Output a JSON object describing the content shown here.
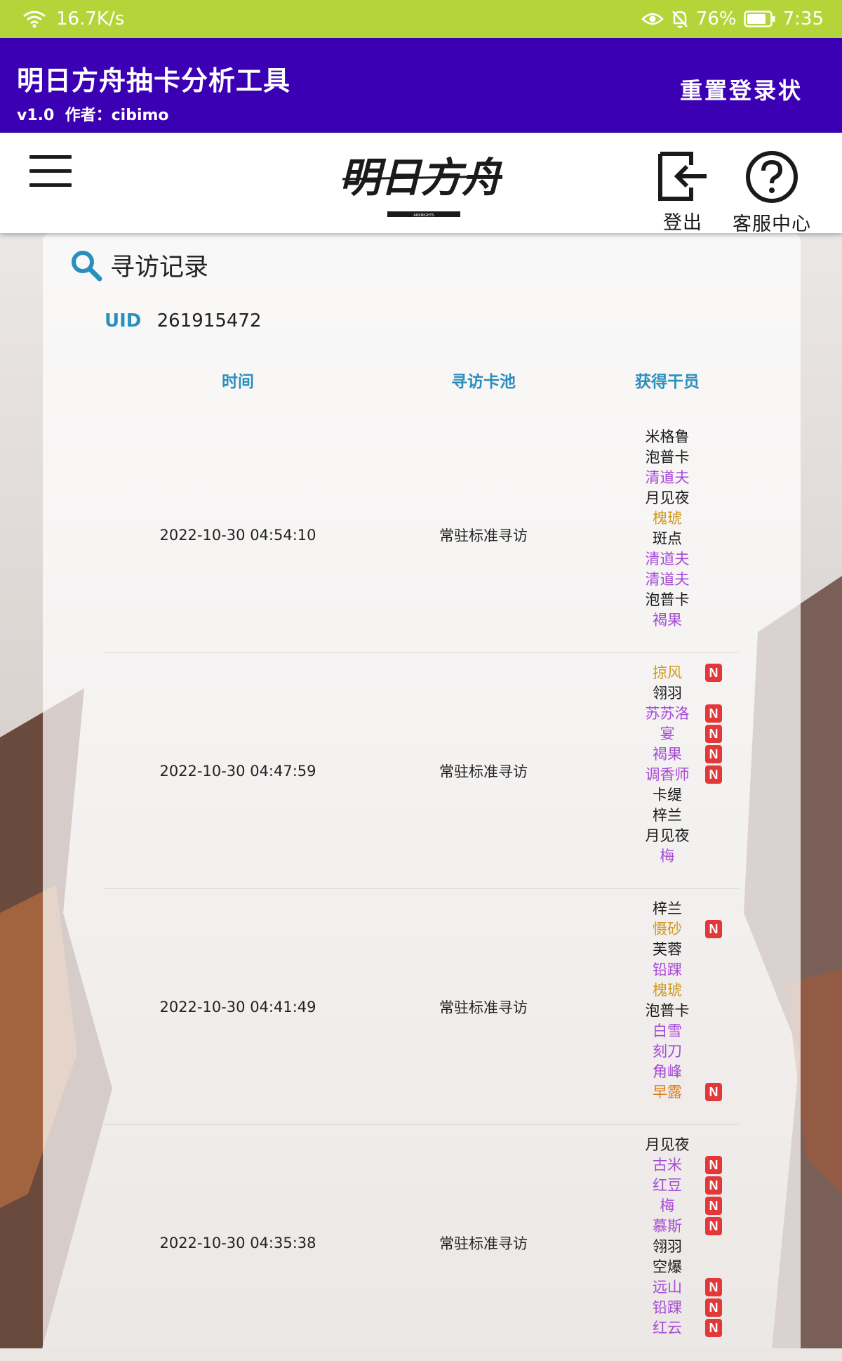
{
  "status_bar": {
    "speed": "16.7K/s",
    "battery": "76%",
    "time": "7:35"
  },
  "app_bar": {
    "title": "明日方舟抽卡分析工具",
    "subtitle": "v1.0  作者：cibimo",
    "reset_label": "重置登录状"
  },
  "nav": {
    "logout_label": "登出",
    "help_label": "客服中心",
    "logo_text": "明日方舟",
    "logo_small": "ARKNIGHTS"
  },
  "card": {
    "title": "寻访记录",
    "uid_label": "UID",
    "uid_value": "261915472",
    "headers": {
      "time": "时间",
      "pool": "寻访卡池",
      "ops": "获得干员"
    }
  },
  "colors": {
    "3star": "#1a1a1a",
    "4star": "#a64bd6",
    "5star": "#d19a1e",
    "6star": "#e07b1a",
    "accent": "#2b8fbd",
    "appbar": "#3b00b4",
    "statusbar": "#b4d53a",
    "new_badge": "#e2383a"
  },
  "new_badge_text": "N",
  "records": [
    {
      "time": "2022-10-30 04:54:10",
      "pool": "常驻标准寻访",
      "ops": [
        {
          "name": "米格鲁",
          "rarity": 3,
          "new": false
        },
        {
          "name": "泡普卡",
          "rarity": 3,
          "new": false
        },
        {
          "name": "清道夫",
          "rarity": 4,
          "new": false
        },
        {
          "name": "月见夜",
          "rarity": 3,
          "new": false
        },
        {
          "name": "槐琥",
          "rarity": 5,
          "new": false
        },
        {
          "name": "斑点",
          "rarity": 3,
          "new": false
        },
        {
          "name": "清道夫",
          "rarity": 4,
          "new": false
        },
        {
          "name": "清道夫",
          "rarity": 4,
          "new": false
        },
        {
          "name": "泡普卡",
          "rarity": 3,
          "new": false
        },
        {
          "name": "褐果",
          "rarity": 4,
          "new": false
        }
      ]
    },
    {
      "time": "2022-10-30 04:47:59",
      "pool": "常驻标准寻访",
      "ops": [
        {
          "name": "掠风",
          "rarity": 5,
          "new": true
        },
        {
          "name": "翎羽",
          "rarity": 3,
          "new": false
        },
        {
          "name": "苏苏洛",
          "rarity": 4,
          "new": true
        },
        {
          "name": "宴",
          "rarity": 4,
          "new": true
        },
        {
          "name": "褐果",
          "rarity": 4,
          "new": true
        },
        {
          "name": "调香师",
          "rarity": 4,
          "new": true
        },
        {
          "name": "卡缇",
          "rarity": 3,
          "new": false
        },
        {
          "name": "梓兰",
          "rarity": 3,
          "new": false
        },
        {
          "name": "月见夜",
          "rarity": 3,
          "new": false
        },
        {
          "name": "梅",
          "rarity": 4,
          "new": false
        }
      ]
    },
    {
      "time": "2022-10-30 04:41:49",
      "pool": "常驻标准寻访",
      "ops": [
        {
          "name": "梓兰",
          "rarity": 3,
          "new": false
        },
        {
          "name": "慑砂",
          "rarity": 5,
          "new": true
        },
        {
          "name": "芙蓉",
          "rarity": 3,
          "new": false
        },
        {
          "name": "铅踝",
          "rarity": 4,
          "new": false
        },
        {
          "name": "槐琥",
          "rarity": 5,
          "new": false
        },
        {
          "name": "泡普卡",
          "rarity": 3,
          "new": false
        },
        {
          "name": "白雪",
          "rarity": 4,
          "new": false
        },
        {
          "name": "刻刀",
          "rarity": 4,
          "new": false
        },
        {
          "name": "角峰",
          "rarity": 4,
          "new": false
        },
        {
          "name": "早露",
          "rarity": 6,
          "new": true
        }
      ]
    },
    {
      "time": "2022-10-30 04:35:38",
      "pool": "常驻标准寻访",
      "ops": [
        {
          "name": "月见夜",
          "rarity": 3,
          "new": false
        },
        {
          "name": "古米",
          "rarity": 4,
          "new": true
        },
        {
          "name": "红豆",
          "rarity": 4,
          "new": true
        },
        {
          "name": "梅",
          "rarity": 4,
          "new": true
        },
        {
          "name": "慕斯",
          "rarity": 4,
          "new": true
        },
        {
          "name": "翎羽",
          "rarity": 3,
          "new": false
        },
        {
          "name": "空爆",
          "rarity": 3,
          "new": false
        },
        {
          "name": "远山",
          "rarity": 4,
          "new": true
        },
        {
          "name": "铅踝",
          "rarity": 4,
          "new": true
        },
        {
          "name": "红云",
          "rarity": 4,
          "new": true
        }
      ]
    }
  ]
}
